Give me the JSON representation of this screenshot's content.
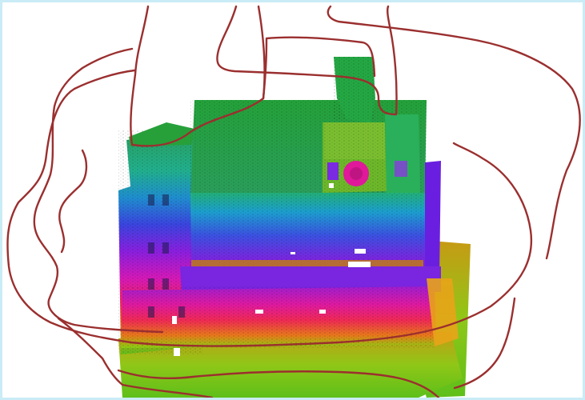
{
  "viewer": {
    "kind": "point-cloud-render",
    "background": "#ffffff",
    "frame_color": "#c9ecf7",
    "colormap": [
      "#2aa84a",
      "#1fb3a8",
      "#2166e0",
      "#7a1fe0",
      "#e01aa0",
      "#ee2a5a",
      "#e07a18",
      "#9ad012"
    ],
    "trajectory_color": "#9b2f2f"
  }
}
